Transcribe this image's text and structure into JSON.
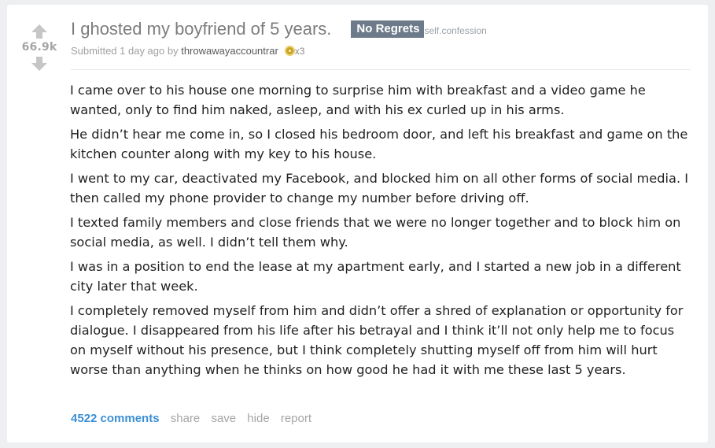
{
  "post": {
    "score": "66.9k",
    "title": "I ghosted my boyfriend of 5 years.",
    "flair": "No Regrets",
    "domain": "self.confession",
    "submitted_prefix": "Submitted 1 day ago by",
    "author": "throwawayaccountrar",
    "award_count": "x3",
    "paragraphs": [
      "I came over to his house one morning to surprise him with breakfast and a video game he wanted, only to find him naked, asleep, and with his ex curled up in his arms.",
      "He didn’t hear me come in, so I closed his bedroom door, and left his breakfast and game on the kitchen counter along with my key to his house.",
      "I went to my car, deactivated my Facebook, and blocked him on all other forms of social media. I then called my phone provider to change my number before driving off.",
      "I texted family members and close friends that we were no longer together and to block him on social media, as well. I didn’t tell them why.",
      "I was in a position to end the lease at my apartment early, and I started a new job in a different city later that week.",
      "I completely removed myself from him and didn’t offer a shred of explanation or opportunity for dialogue. I disappeared from his life after his betrayal and I think it’ll not only help me to focus on myself without his presence, but I think completely shutting myself off from him will hurt worse than anything when he thinks on how good he had it with me these last 5 years."
    ]
  },
  "actions": {
    "comments": "4522 comments",
    "share": "share",
    "save": "save",
    "hide": "hide",
    "report": "report"
  },
  "colors": {
    "accent": "#3b8fd4",
    "flair_bg": "#6c7a8a",
    "muted": "#a5a5a5"
  },
  "icons": {
    "upvote": "upvote-arrow-icon",
    "downvote": "downvote-arrow-icon",
    "award": "award-icon"
  }
}
